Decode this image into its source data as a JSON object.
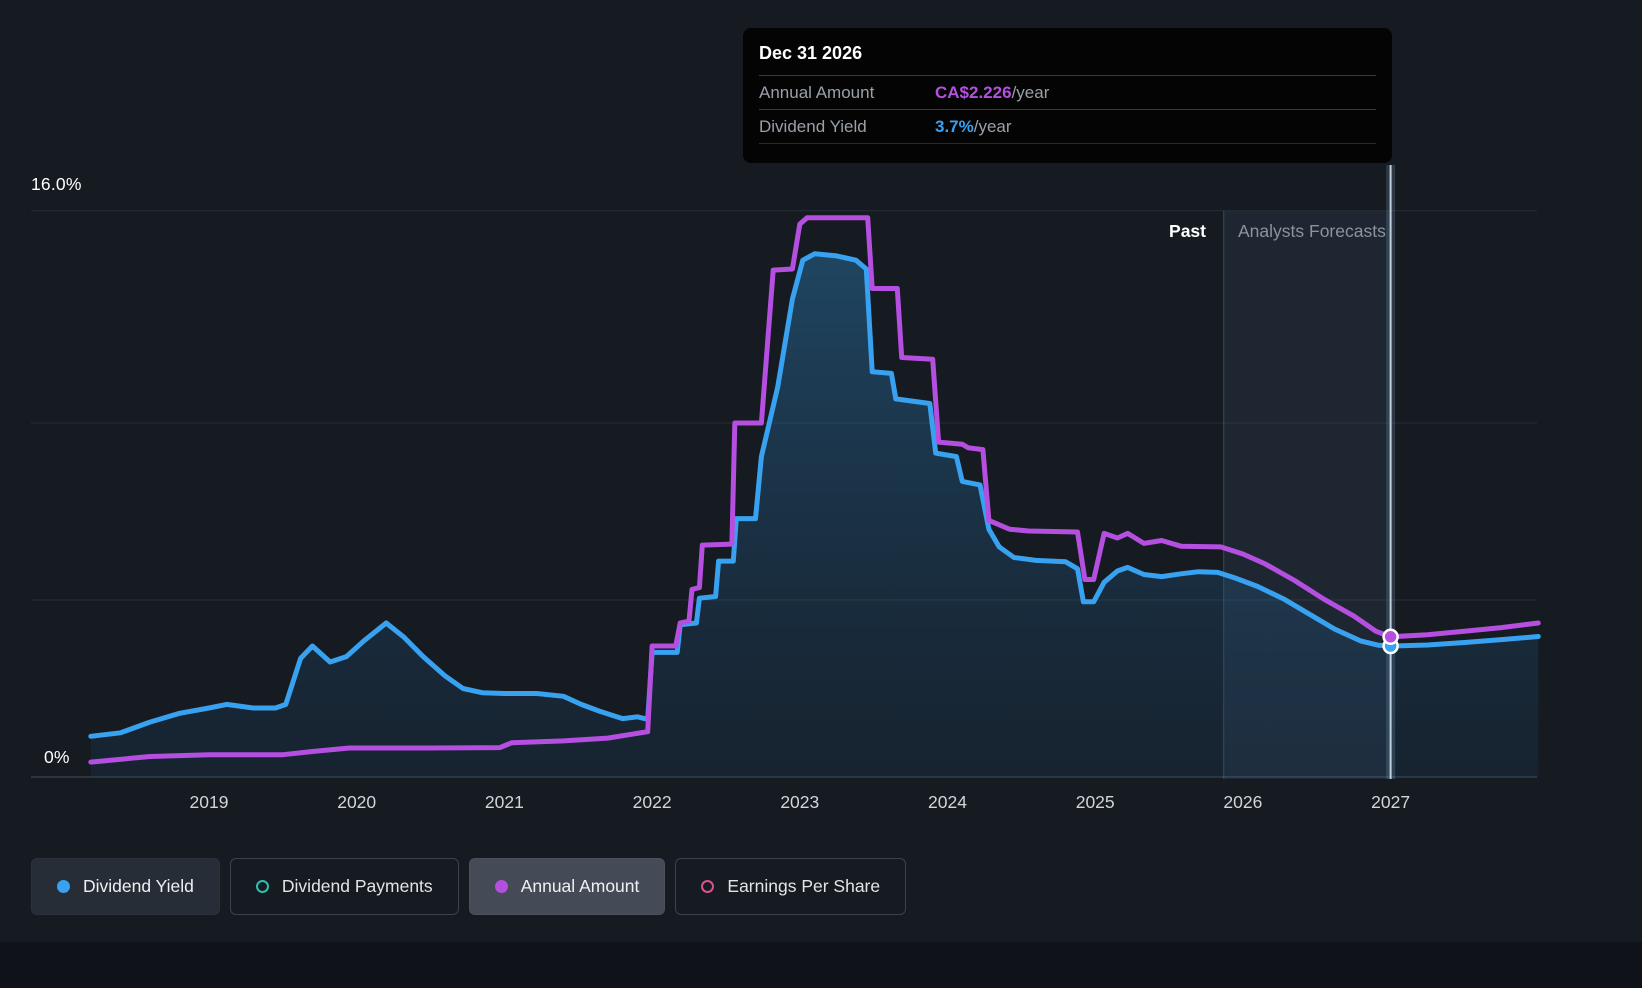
{
  "tooltip": {
    "date": "Dec 31 2026",
    "rows": [
      {
        "label": "Annual Amount",
        "value": "CA$2.226",
        "suffix": "/year",
        "color": "#b44fe0"
      },
      {
        "label": "Dividend Yield",
        "value": "3.7%",
        "suffix": "/year",
        "color": "#38a1f0"
      }
    ]
  },
  "axis": {
    "y_top_label": "16.0%",
    "y_bottom_label": "0%"
  },
  "annotations": {
    "past_label": "Past",
    "forecast_label": "Analysts Forecasts"
  },
  "legend": [
    {
      "label": "Dividend Yield",
      "color": "#38a1f0",
      "style": "filled",
      "active": true,
      "highlight": false
    },
    {
      "label": "Dividend Payments",
      "color": "#2fbfae",
      "style": "outline",
      "active": false,
      "highlight": false
    },
    {
      "label": "Annual Amount",
      "color": "#b44fe0",
      "style": "filled",
      "active": true,
      "highlight": true
    },
    {
      "label": "Earnings Per Share",
      "color": "#d9538f",
      "style": "outline",
      "active": false,
      "highlight": false
    }
  ],
  "chart_data": {
    "type": "line",
    "title": "Dividend yield history and analyst forecast",
    "x_range": [
      2018.2,
      2028.0
    ],
    "y_range": [
      0,
      16.0
    ],
    "x_ticks": [
      2019,
      2020,
      2021,
      2022,
      2023,
      2024,
      2025,
      2026,
      2027
    ],
    "gridlines_pct": [
      16,
      10,
      5,
      0
    ],
    "grid": true,
    "legend_position": "bottom",
    "forecast_start_x": 2025.87,
    "marker_x": 2027.0,
    "series": [
      {
        "name": "Dividend Yield",
        "unit": "%",
        "color": "#38a1f0",
        "area": true,
        "marker_value": 3.7,
        "points": [
          [
            2018.2,
            1.15
          ],
          [
            2018.4,
            1.25
          ],
          [
            2018.6,
            1.55
          ],
          [
            2018.8,
            1.8
          ],
          [
            2019.0,
            1.95
          ],
          [
            2019.12,
            2.05
          ],
          [
            2019.3,
            1.95
          ],
          [
            2019.45,
            1.95
          ],
          [
            2019.52,
            2.05
          ],
          [
            2019.62,
            3.35
          ],
          [
            2019.7,
            3.7
          ],
          [
            2019.82,
            3.25
          ],
          [
            2019.93,
            3.4
          ],
          [
            2020.05,
            3.85
          ],
          [
            2020.2,
            4.35
          ],
          [
            2020.32,
            3.95
          ],
          [
            2020.45,
            3.4
          ],
          [
            2020.6,
            2.85
          ],
          [
            2020.72,
            2.5
          ],
          [
            2020.85,
            2.38
          ],
          [
            2021.0,
            2.36
          ],
          [
            2021.22,
            2.36
          ],
          [
            2021.4,
            2.28
          ],
          [
            2021.52,
            2.05
          ],
          [
            2021.65,
            1.85
          ],
          [
            2021.8,
            1.65
          ],
          [
            2021.9,
            1.7
          ],
          [
            2021.97,
            1.63
          ],
          [
            2022.0,
            3.52
          ],
          [
            2022.17,
            3.52
          ],
          [
            2022.19,
            4.3
          ],
          [
            2022.3,
            4.35
          ],
          [
            2022.32,
            5.05
          ],
          [
            2022.43,
            5.1
          ],
          [
            2022.45,
            6.1
          ],
          [
            2022.55,
            6.1
          ],
          [
            2022.57,
            7.3
          ],
          [
            2022.7,
            7.3
          ],
          [
            2022.74,
            9.05
          ],
          [
            2022.85,
            11.0
          ],
          [
            2022.95,
            13.5
          ],
          [
            2023.02,
            14.6
          ],
          [
            2023.1,
            14.78
          ],
          [
            2023.25,
            14.72
          ],
          [
            2023.38,
            14.6
          ],
          [
            2023.45,
            14.35
          ],
          [
            2023.49,
            11.45
          ],
          [
            2023.62,
            11.4
          ],
          [
            2023.65,
            10.68
          ],
          [
            2023.88,
            10.55
          ],
          [
            2023.92,
            9.15
          ],
          [
            2024.06,
            9.05
          ],
          [
            2024.1,
            8.35
          ],
          [
            2024.22,
            8.25
          ],
          [
            2024.28,
            7.0
          ],
          [
            2024.35,
            6.5
          ],
          [
            2024.45,
            6.2
          ],
          [
            2024.6,
            6.12
          ],
          [
            2024.8,
            6.08
          ],
          [
            2024.88,
            5.88
          ],
          [
            2024.92,
            4.95
          ],
          [
            2024.99,
            4.95
          ],
          [
            2025.06,
            5.5
          ],
          [
            2025.15,
            5.82
          ],
          [
            2025.22,
            5.92
          ],
          [
            2025.33,
            5.72
          ],
          [
            2025.45,
            5.66
          ],
          [
            2025.58,
            5.74
          ],
          [
            2025.7,
            5.8
          ],
          [
            2025.83,
            5.78
          ],
          [
            2025.95,
            5.62
          ],
          [
            2026.1,
            5.38
          ],
          [
            2026.28,
            5.02
          ],
          [
            2026.45,
            4.6
          ],
          [
            2026.62,
            4.18
          ],
          [
            2026.8,
            3.84
          ],
          [
            2026.92,
            3.72
          ],
          [
            2027.0,
            3.7
          ],
          [
            2027.25,
            3.73
          ],
          [
            2027.5,
            3.8
          ],
          [
            2027.75,
            3.88
          ],
          [
            2028.0,
            3.97
          ]
        ]
      },
      {
        "name": "Annual Amount",
        "unit": "CA$/year (plotted on shared scale)",
        "color": "#b44fe0",
        "area": false,
        "marker_value": 3.96,
        "points": [
          [
            2018.2,
            0.42
          ],
          [
            2018.6,
            0.58
          ],
          [
            2019.0,
            0.63
          ],
          [
            2019.5,
            0.63
          ],
          [
            2019.7,
            0.72
          ],
          [
            2019.95,
            0.82
          ],
          [
            2020.5,
            0.82
          ],
          [
            2020.97,
            0.83
          ],
          [
            2021.05,
            0.97
          ],
          [
            2021.4,
            1.02
          ],
          [
            2021.7,
            1.1
          ],
          [
            2021.88,
            1.22
          ],
          [
            2021.97,
            1.28
          ],
          [
            2022.0,
            3.7
          ],
          [
            2022.16,
            3.7
          ],
          [
            2022.19,
            4.35
          ],
          [
            2022.25,
            4.4
          ],
          [
            2022.27,
            5.3
          ],
          [
            2022.32,
            5.35
          ],
          [
            2022.34,
            6.55
          ],
          [
            2022.54,
            6.58
          ],
          [
            2022.56,
            10.0
          ],
          [
            2022.74,
            10.0
          ],
          [
            2022.82,
            14.32
          ],
          [
            2022.95,
            14.35
          ],
          [
            2023.0,
            15.62
          ],
          [
            2023.05,
            15.8
          ],
          [
            2023.46,
            15.8
          ],
          [
            2023.49,
            13.8
          ],
          [
            2023.66,
            13.8
          ],
          [
            2023.69,
            11.85
          ],
          [
            2023.9,
            11.8
          ],
          [
            2023.94,
            9.46
          ],
          [
            2024.1,
            9.4
          ],
          [
            2024.14,
            9.3
          ],
          [
            2024.24,
            9.25
          ],
          [
            2024.28,
            7.25
          ],
          [
            2024.42,
            7.0
          ],
          [
            2024.55,
            6.95
          ],
          [
            2024.88,
            6.92
          ],
          [
            2024.93,
            5.58
          ],
          [
            2024.99,
            5.58
          ],
          [
            2025.06,
            6.88
          ],
          [
            2025.15,
            6.75
          ],
          [
            2025.22,
            6.88
          ],
          [
            2025.33,
            6.6
          ],
          [
            2025.45,
            6.68
          ],
          [
            2025.58,
            6.52
          ],
          [
            2025.85,
            6.5
          ],
          [
            2026.0,
            6.3
          ],
          [
            2026.15,
            6.02
          ],
          [
            2026.35,
            5.55
          ],
          [
            2026.55,
            5.02
          ],
          [
            2026.75,
            4.55
          ],
          [
            2026.9,
            4.12
          ],
          [
            2027.0,
            3.96
          ],
          [
            2027.25,
            4.02
          ],
          [
            2027.5,
            4.12
          ],
          [
            2027.75,
            4.22
          ],
          [
            2028.0,
            4.35
          ]
        ]
      }
    ]
  }
}
